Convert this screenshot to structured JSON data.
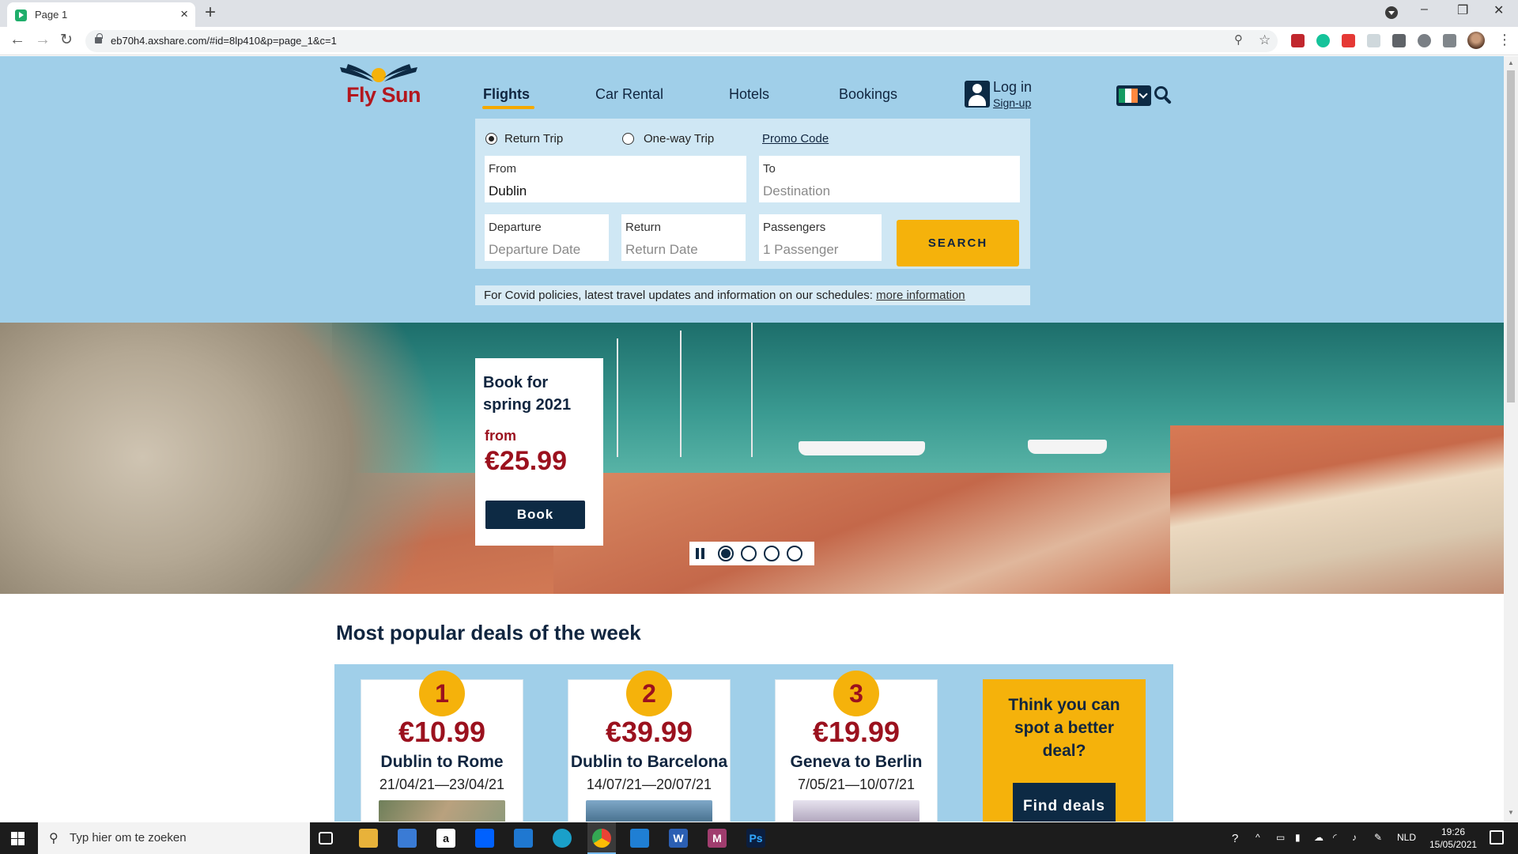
{
  "browser": {
    "tab_title": "Page 1",
    "new_tab": "+",
    "url": "eb70h4.axshare.com/#id=8lp410&p=page_1&c=1",
    "win_minimize": "–",
    "win_restore": "❐",
    "win_close": "✕"
  },
  "site": {
    "logo": "Fly Sun",
    "nav": [
      {
        "label": "Flights",
        "active": true
      },
      {
        "label": "Car Rental"
      },
      {
        "label": "Hotels"
      },
      {
        "label": "Bookings"
      }
    ],
    "login": "Log in",
    "signup": "Sign-up"
  },
  "search_form": {
    "return_trip": "Return Trip",
    "one_way": "One-way Trip",
    "promo": "Promo Code",
    "from_label": "From",
    "from_value": "Dublin",
    "to_label": "To",
    "to_placeholder": "Destination",
    "departure_label": "Departure",
    "departure_placeholder": "Departure Date",
    "return_label": "Return",
    "return_placeholder": "Return Date",
    "passengers_label": "Passengers",
    "passengers_placeholder": "1 Passenger",
    "search_button": "SEARCH"
  },
  "covid": {
    "text": "For Covid policies, latest travel updates and information on our schedules: ",
    "link": "more information"
  },
  "hero": {
    "title": "Book for spring 2021",
    "from": "from",
    "price": "€25.99",
    "book": "Book",
    "slides": 4,
    "active_slide": 1
  },
  "deals": {
    "title": "Most popular deals of the week",
    "items": [
      {
        "rank": "1",
        "price": "€10.99",
        "route": "Dublin to Rome",
        "dates": "21/04/21—23/04/21"
      },
      {
        "rank": "2",
        "price": "€39.99",
        "route": "Dublin to Barcelona",
        "dates": "14/07/21—20/07/21"
      },
      {
        "rank": "3",
        "price": "€19.99",
        "route": "Geneva to Berlin",
        "dates": "7/05/21—10/07/21"
      }
    ],
    "cta_text": "Think you can spot a better deal?",
    "cta_button": "Find deals"
  },
  "taskbar": {
    "search_placeholder": "Typ hier om te zoeken",
    "lang": "NLD",
    "time": "19:26",
    "date": "15/05/2021"
  },
  "colors": {
    "header_bg": "#a0cfe9",
    "navy": "#0d2a44",
    "accent": "#f5b20b",
    "price_red": "#9b111e"
  }
}
